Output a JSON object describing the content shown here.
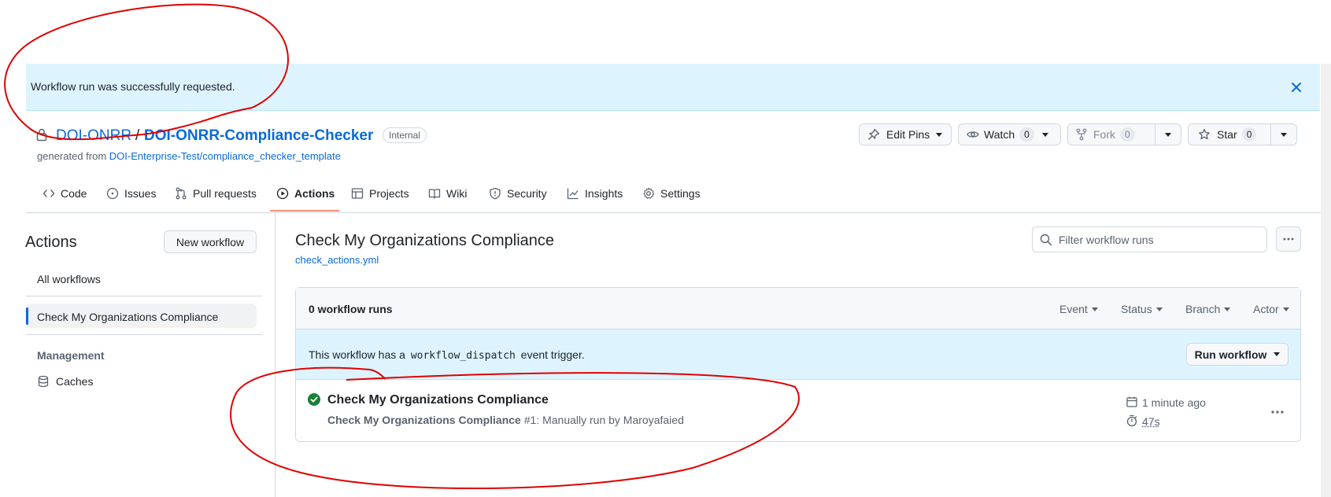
{
  "flash": {
    "message": "Workflow run was successfully requested."
  },
  "repo": {
    "owner": "DOI-ONRR",
    "separator": "/",
    "name": "DOI-ONRR-Compliance-Checker",
    "visibility": "Internal",
    "generated_prefix": "generated from",
    "template": "DOI-Enterprise-Test/compliance_checker_template"
  },
  "header_actions": {
    "edit_pins": "Edit Pins",
    "watch": {
      "label": "Watch",
      "count": "0"
    },
    "fork": {
      "label": "Fork",
      "count": "0"
    },
    "star": {
      "label": "Star",
      "count": "0"
    }
  },
  "tabs": [
    {
      "label": "Code",
      "icon": "code-icon"
    },
    {
      "label": "Issues",
      "icon": "issue-opened-icon"
    },
    {
      "label": "Pull requests",
      "icon": "git-pull-request-icon"
    },
    {
      "label": "Actions",
      "icon": "play-icon",
      "selected": true
    },
    {
      "label": "Projects",
      "icon": "table-icon"
    },
    {
      "label": "Wiki",
      "icon": "book-icon"
    },
    {
      "label": "Security",
      "icon": "shield-icon"
    },
    {
      "label": "Insights",
      "icon": "graph-icon"
    },
    {
      "label": "Settings",
      "icon": "gear-icon"
    }
  ],
  "sidebar": {
    "title": "Actions",
    "new_workflow": "New workflow",
    "all_workflows": "All workflows",
    "selected_workflow": "Check My Organizations Compliance",
    "management_heading": "Management",
    "caches": "Caches"
  },
  "workflow": {
    "title": "Check My Organizations Compliance",
    "file": "check_actions.yml",
    "filter_placeholder": "Filter workflow runs"
  },
  "runs": {
    "count_label": "0 workflow runs",
    "filters": [
      "Event",
      "Status",
      "Branch",
      "Actor"
    ],
    "dispatch_prefix": "This workflow has a",
    "dispatch_code": "workflow_dispatch",
    "dispatch_suffix": "event trigger.",
    "run_workflow": "Run workflow",
    "items": [
      {
        "status": "success",
        "title": "Check My Organizations Compliance",
        "workflow_name": "Check My Organizations Compliance",
        "run_number": "#1",
        "trigger": ": Manually run by Maroyafaied",
        "time": "1 minute ago",
        "duration": "47s"
      }
    ]
  },
  "colors": {
    "accent": "#0969da",
    "success": "#1a7f37",
    "flash_bg": "#ddf4ff",
    "selected_tab_underline": "#fd8c73",
    "annotation": "#e00000"
  }
}
